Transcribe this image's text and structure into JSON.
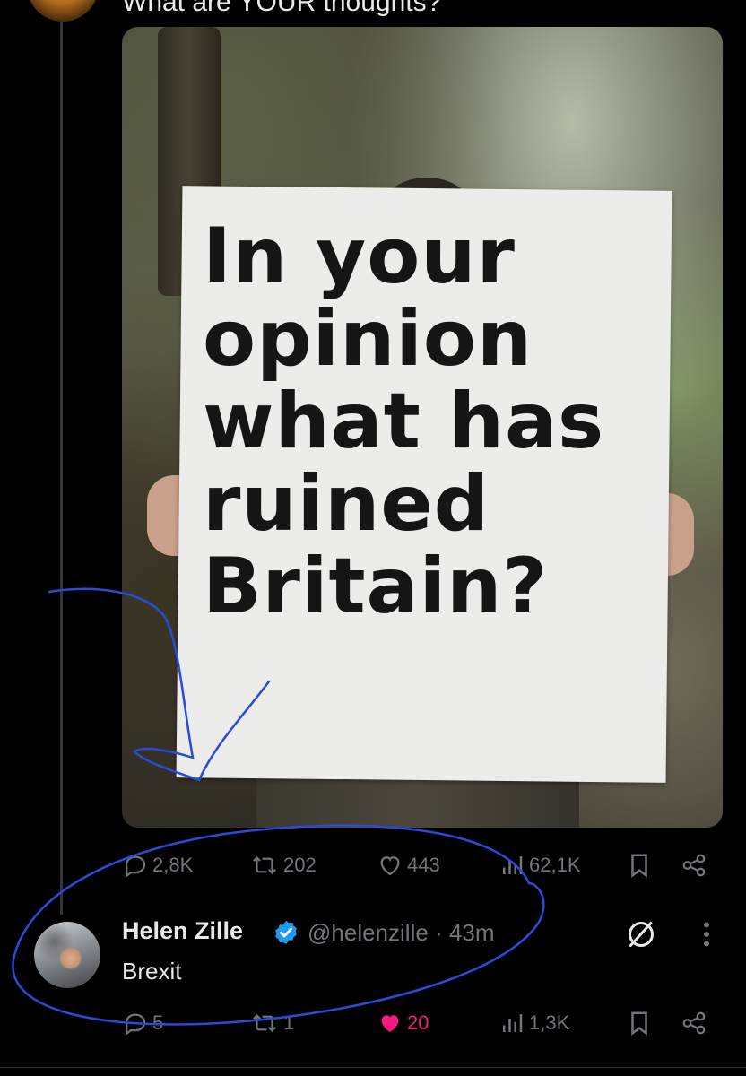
{
  "top_tweet": {
    "text": "What are YOUR thoughts?"
  },
  "media": {
    "sign_text": "In your\nopinion\nwhat has\nruined\nBritain?"
  },
  "post_actions": {
    "replies": "2,8K",
    "reposts": "202",
    "likes": "443",
    "views": "62,1K"
  },
  "reply": {
    "name": "Helen Zille",
    "handle": "@helenzille",
    "separator": "·",
    "time": "43m",
    "text": "Brexit",
    "actions": {
      "replies": "5",
      "reposts": "1",
      "likes": "20",
      "views": "1,3K"
    }
  },
  "colors": {
    "background": "#000000",
    "text_primary": "#e7e9ea",
    "text_secondary": "#71767b",
    "verified": "#1d9bf0",
    "like_active": "#f91880",
    "annotation": "#2a4bd7"
  },
  "icons": {
    "reply": "speech-bubble-icon",
    "repost": "repost-icon",
    "like": "heart-icon",
    "views": "bar-chart-icon",
    "bookmark": "bookmark-icon",
    "share": "share-icon",
    "grok": "grok-icon",
    "more": "more-icon",
    "verified": "verified-badge-icon"
  }
}
